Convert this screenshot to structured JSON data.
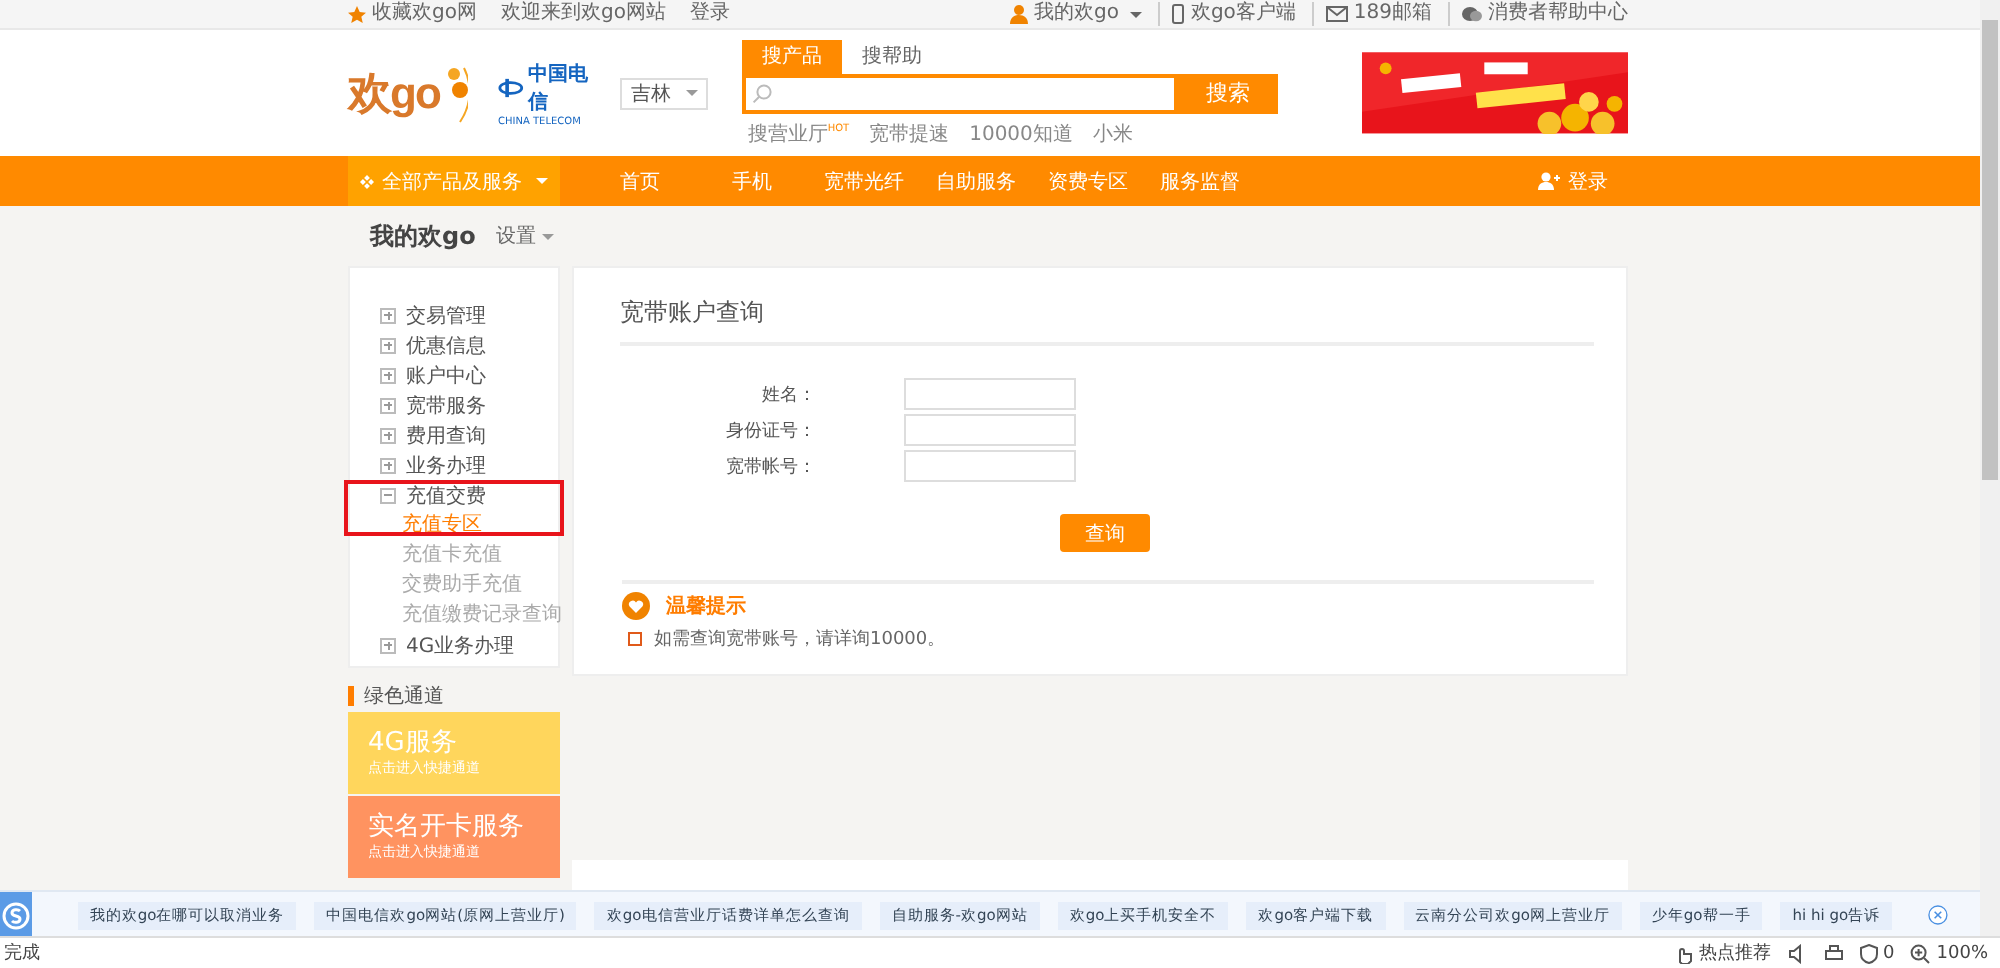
{
  "top_bar": {
    "left": [
      {
        "kind": "star",
        "label": "收藏欢go网"
      },
      {
        "kind": "plain",
        "label": "欢迎来到欢go网站"
      },
      {
        "kind": "plain",
        "label": "登录"
      }
    ],
    "right": [
      {
        "kind": "user",
        "label": "我的欢go"
      },
      {
        "kind": "phone",
        "label": "欢go客户端"
      },
      {
        "kind": "mail",
        "label": "189邮箱"
      },
      {
        "kind": "help",
        "label": "消费者帮助中心"
      }
    ]
  },
  "header": {
    "logo": "欢go",
    "partner_logo": "中国电信",
    "partner_logo_en": "CHINA TELECOM",
    "region": "吉林",
    "search_tabs": [
      {
        "label": "搜产品",
        "selected": true
      },
      {
        "label": "搜帮助",
        "selected": false
      }
    ],
    "search_button": "搜索",
    "hot_links": [
      {
        "label": "搜营业厅",
        "badge": "HOT"
      },
      {
        "label": "宽带提速"
      },
      {
        "label": "10000知道"
      },
      {
        "label": "小米"
      }
    ]
  },
  "nav": {
    "all_products": "全部产品及服务",
    "items": [
      "首页",
      "手机",
      "宽带光纤",
      "自助服务",
      "资费专区",
      "服务监督"
    ],
    "login": "登录"
  },
  "page_title": "我的欢go",
  "settings": "设置",
  "sidebar": {
    "items": [
      {
        "label": "交易管理",
        "expanded": false
      },
      {
        "label": "优惠信息",
        "expanded": false
      },
      {
        "label": "账户中心",
        "expanded": false
      },
      {
        "label": "宽带服务",
        "expanded": false
      },
      {
        "label": "费用查询",
        "expanded": false
      },
      {
        "label": "业务办理",
        "expanded": false
      },
      {
        "label": "充值交费",
        "expanded": true,
        "children": [
          {
            "label": "充值专区",
            "selected": true
          },
          {
            "label": "充值卡充值",
            "selected": false
          },
          {
            "label": "交费助手充值",
            "selected": false
          },
          {
            "label": "充值缴费记录查询",
            "selected": false
          }
        ]
      },
      {
        "label": "4G业务办理",
        "expanded": false
      }
    ]
  },
  "green_channel": {
    "title": "绿色通道",
    "cards": [
      {
        "title": "4G服务",
        "subtitle": "点击进入快捷通道",
        "color": "#ffd65c"
      },
      {
        "title": "实名开卡服务",
        "subtitle": "点击进入快捷通道",
        "color": "#ff9360"
      }
    ]
  },
  "query": {
    "title": "宽带账户查询",
    "fields": [
      {
        "label": "姓名："
      },
      {
        "label": "身份证号："
      },
      {
        "label": "宽带帐号："
      }
    ],
    "button": "查询",
    "tip_title": "温馨提示",
    "tips": [
      "如需查询宽带账号，请详询10000。"
    ]
  },
  "bottom_bar": {
    "links": [
      "我的欢go在哪可以取消业务",
      "中国电信欢go网站(原网上营业厅)",
      "欢go电信营业厅话费详单怎么查询",
      "自助服务-欢go网站",
      "欢go上买手机安全不",
      "欢go客户端下载",
      "云南分公司欢go网上营业厅",
      "少年go帮一手",
      "hi hi go告诉"
    ]
  },
  "status_bar": {
    "status": "完成",
    "hot": "热点推荐",
    "count": "0",
    "zoom": "100%"
  }
}
